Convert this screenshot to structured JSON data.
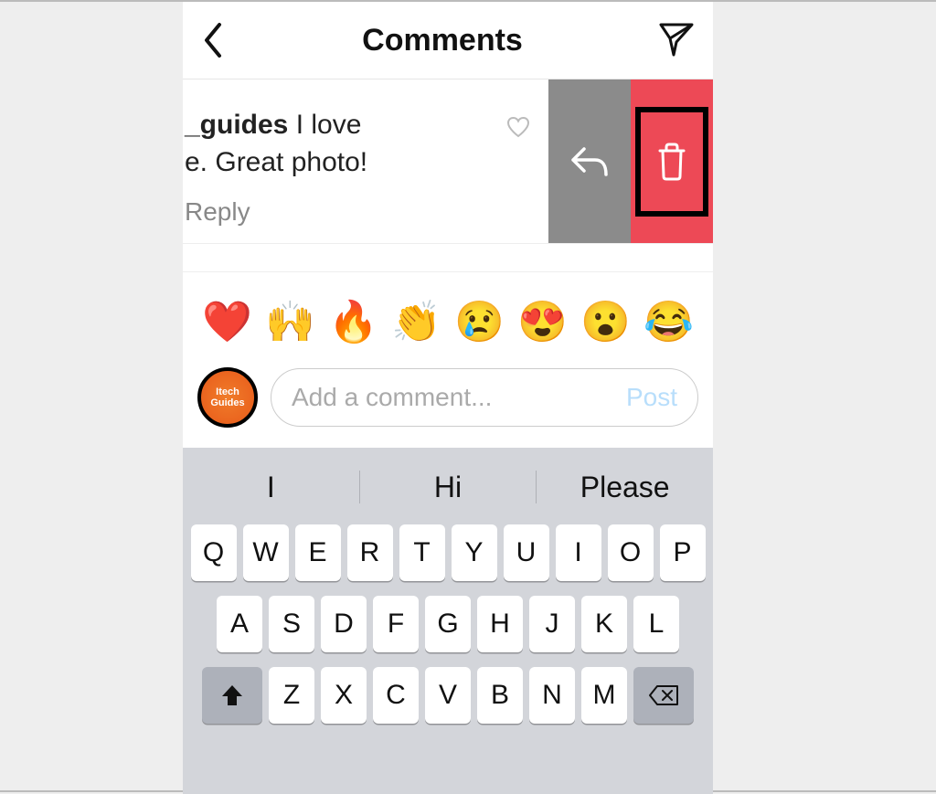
{
  "header": {
    "title": "Comments"
  },
  "comment": {
    "username_fragment": "_guides",
    "text_line1": " I love",
    "text_line2": "e. Great photo!",
    "reply_label": "Reply"
  },
  "emoji_bar": [
    "❤️",
    "🙌",
    "🔥",
    "👏",
    "😢",
    "😍",
    "😮",
    "😂"
  ],
  "avatar": {
    "line1": "Itech",
    "line2": "Guides"
  },
  "input": {
    "placeholder": "Add a comment...",
    "post_label": "Post"
  },
  "keyboard": {
    "suggestions": [
      "I",
      "Hi",
      "Please"
    ],
    "row1": [
      "Q",
      "W",
      "E",
      "R",
      "T",
      "Y",
      "U",
      "I",
      "O",
      "P"
    ],
    "row2": [
      "A",
      "S",
      "D",
      "F",
      "G",
      "H",
      "J",
      "K",
      "L"
    ],
    "row3": [
      "Z",
      "X",
      "C",
      "V",
      "B",
      "N",
      "M"
    ]
  }
}
